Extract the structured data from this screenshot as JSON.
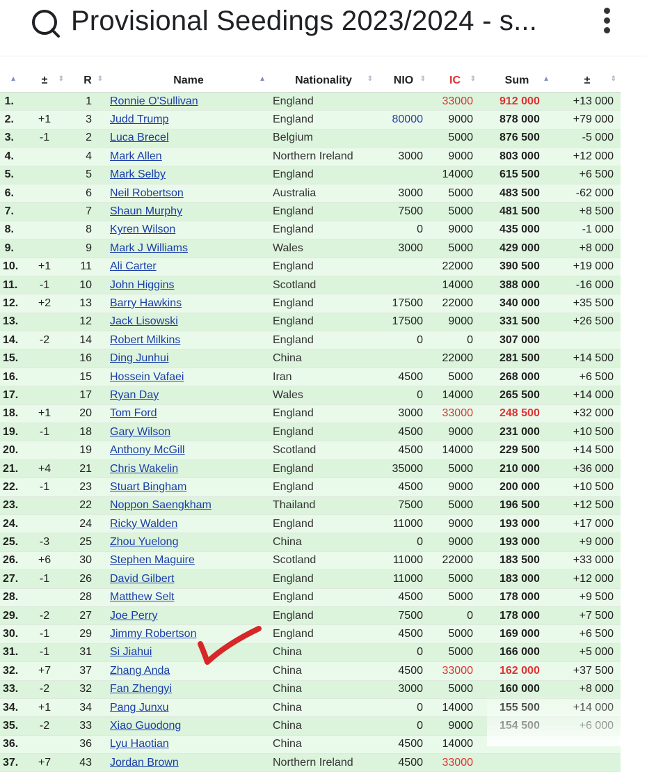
{
  "header": {
    "title": "Provisional Seedings 2023/2024 - s..."
  },
  "columns": [
    "",
    "±",
    "R",
    "Name",
    "Nationality",
    "NIO",
    "IC",
    "Sum",
    "±"
  ],
  "rows": [
    {
      "pos": "1.",
      "chg": "",
      "r": "1",
      "name": "Ronnie O'Sullivan",
      "nat": "England",
      "nio": "",
      "ic": "33000",
      "sum": "912 000",
      "diff": "+13 000",
      "ic_red": true,
      "sum_red": true
    },
    {
      "pos": "2.",
      "chg": "+1",
      "r": "3",
      "name": "Judd Trump",
      "nat": "England",
      "nio": "80000",
      "ic": "9000",
      "sum": "878 000",
      "diff": "+79 000",
      "nio_blue": true
    },
    {
      "pos": "3.",
      "chg": "-1",
      "r": "2",
      "name": "Luca Brecel",
      "nat": "Belgium",
      "nio": "",
      "ic": "5000",
      "sum": "876 500",
      "diff": "-5 000"
    },
    {
      "pos": "4.",
      "chg": "",
      "r": "4",
      "name": "Mark Allen",
      "nat": "Northern Ireland",
      "nio": "3000",
      "ic": "9000",
      "sum": "803 000",
      "diff": "+12 000"
    },
    {
      "pos": "5.",
      "chg": "",
      "r": "5",
      "name": "Mark Selby",
      "nat": "England",
      "nio": "",
      "ic": "14000",
      "sum": "615 500",
      "diff": "+6 500"
    },
    {
      "pos": "6.",
      "chg": "",
      "r": "6",
      "name": "Neil Robertson",
      "nat": "Australia",
      "nio": "3000",
      "ic": "5000",
      "sum": "483 500",
      "diff": "-62 000"
    },
    {
      "pos": "7.",
      "chg": "",
      "r": "7",
      "name": "Shaun Murphy",
      "nat": "England",
      "nio": "7500",
      "ic": "5000",
      "sum": "481 500",
      "diff": "+8 500"
    },
    {
      "pos": "8.",
      "chg": "",
      "r": "8",
      "name": "Kyren Wilson",
      "nat": "England",
      "nio": "0",
      "ic": "9000",
      "sum": "435 000",
      "diff": "-1 000"
    },
    {
      "pos": "9.",
      "chg": "",
      "r": "9",
      "name": "Mark J Williams",
      "nat": "Wales",
      "nio": "3000",
      "ic": "5000",
      "sum": "429 000",
      "diff": "+8 000"
    },
    {
      "pos": "10.",
      "chg": "+1",
      "r": "11",
      "name": "Ali Carter",
      "nat": "England",
      "nio": "",
      "ic": "22000",
      "sum": "390 500",
      "diff": "+19 000"
    },
    {
      "pos": "11.",
      "chg": "-1",
      "r": "10",
      "name": "John Higgins",
      "nat": "Scotland",
      "nio": "",
      "ic": "14000",
      "sum": "388 000",
      "diff": "-16 000"
    },
    {
      "pos": "12.",
      "chg": "+2",
      "r": "13",
      "name": "Barry Hawkins",
      "nat": "England",
      "nio": "17500",
      "ic": "22000",
      "sum": "340 000",
      "diff": "+35 500"
    },
    {
      "pos": "13.",
      "chg": "",
      "r": "12",
      "name": "Jack Lisowski",
      "nat": "England",
      "nio": "17500",
      "ic": "9000",
      "sum": "331 500",
      "diff": "+26 500"
    },
    {
      "pos": "14.",
      "chg": "-2",
      "r": "14",
      "name": "Robert Milkins",
      "nat": "England",
      "nio": "0",
      "ic": "0",
      "sum": "307 000",
      "diff": ""
    },
    {
      "pos": "15.",
      "chg": "",
      "r": "16",
      "name": "Ding Junhui",
      "nat": "China",
      "nio": "",
      "ic": "22000",
      "sum": "281 500",
      "diff": "+14 500"
    },
    {
      "pos": "16.",
      "chg": "",
      "r": "15",
      "name": "Hossein Vafaei",
      "nat": "Iran",
      "nio": "4500",
      "ic": "5000",
      "sum": "268 000",
      "diff": "+6 500"
    },
    {
      "pos": "17.",
      "chg": "",
      "r": "17",
      "name": "Ryan Day",
      "nat": "Wales",
      "nio": "0",
      "ic": "14000",
      "sum": "265 500",
      "diff": "+14 000"
    },
    {
      "pos": "18.",
      "chg": "+1",
      "r": "20",
      "name": "Tom Ford",
      "nat": "England",
      "nio": "3000",
      "ic": "33000",
      "sum": "248 500",
      "diff": "+32 000",
      "ic_red": true,
      "sum_red": true
    },
    {
      "pos": "19.",
      "chg": "-1",
      "r": "18",
      "name": "Gary Wilson",
      "nat": "England",
      "nio": "4500",
      "ic": "9000",
      "sum": "231 000",
      "diff": "+10 500"
    },
    {
      "pos": "20.",
      "chg": "",
      "r": "19",
      "name": "Anthony McGill",
      "nat": "Scotland",
      "nio": "4500",
      "ic": "14000",
      "sum": "229 500",
      "diff": "+14 500"
    },
    {
      "pos": "21.",
      "chg": "+4",
      "r": "21",
      "name": "Chris Wakelin",
      "nat": "England",
      "nio": "35000",
      "ic": "5000",
      "sum": "210 000",
      "diff": "+36 000"
    },
    {
      "pos": "22.",
      "chg": "-1",
      "r": "23",
      "name": "Stuart Bingham",
      "nat": "England",
      "nio": "4500",
      "ic": "9000",
      "sum": "200 000",
      "diff": "+10 500"
    },
    {
      "pos": "23.",
      "chg": "",
      "r": "22",
      "name": "Noppon Saengkham",
      "nat": "Thailand",
      "nio": "7500",
      "ic": "5000",
      "sum": "196 500",
      "diff": "+12 500"
    },
    {
      "pos": "24.",
      "chg": "",
      "r": "24",
      "name": "Ricky Walden",
      "nat": "England",
      "nio": "11000",
      "ic": "9000",
      "sum": "193 000",
      "diff": "+17 000"
    },
    {
      "pos": "25.",
      "chg": "-3",
      "r": "25",
      "name": "Zhou Yuelong",
      "nat": "China",
      "nio": "0",
      "ic": "9000",
      "sum": "193 000",
      "diff": "+9 000"
    },
    {
      "pos": "26.",
      "chg": "+6",
      "r": "30",
      "name": "Stephen Maguire",
      "nat": "Scotland",
      "nio": "11000",
      "ic": "22000",
      "sum": "183 500",
      "diff": "+33 000"
    },
    {
      "pos": "27.",
      "chg": "-1",
      "r": "26",
      "name": "David Gilbert",
      "nat": "England",
      "nio": "11000",
      "ic": "5000",
      "sum": "183 000",
      "diff": "+12 000"
    },
    {
      "pos": "28.",
      "chg": "",
      "r": "28",
      "name": "Matthew Selt",
      "nat": "England",
      "nio": "4500",
      "ic": "5000",
      "sum": "178 000",
      "diff": "+9 500"
    },
    {
      "pos": "29.",
      "chg": "-2",
      "r": "27",
      "name": "Joe Perry",
      "nat": "England",
      "nio": "7500",
      "ic": "0",
      "sum": "178 000",
      "diff": "+7 500"
    },
    {
      "pos": "30.",
      "chg": "-1",
      "r": "29",
      "name": "Jimmy Robertson",
      "nat": "England",
      "nio": "4500",
      "ic": "5000",
      "sum": "169 000",
      "diff": "+6 500"
    },
    {
      "pos": "31.",
      "chg": "-1",
      "r": "31",
      "name": "Si Jiahui",
      "nat": "China",
      "nio": "0",
      "ic": "5000",
      "sum": "166 000",
      "diff": "+5 000"
    },
    {
      "pos": "32.",
      "chg": "+7",
      "r": "37",
      "name": "Zhang Anda",
      "nat": "China",
      "nio": "4500",
      "ic": "33000",
      "sum": "162 000",
      "diff": "+37 500",
      "ic_red": true,
      "sum_red": true
    },
    {
      "pos": "33.",
      "chg": "-2",
      "r": "32",
      "name": "Fan Zhengyi",
      "nat": "China",
      "nio": "3000",
      "ic": "5000",
      "sum": "160 000",
      "diff": "+8 000"
    },
    {
      "pos": "34.",
      "chg": "+1",
      "r": "34",
      "name": "Pang Junxu",
      "nat": "China",
      "nio": "0",
      "ic": "14000",
      "sum": "155 500",
      "diff": "+14 000"
    },
    {
      "pos": "35.",
      "chg": "-2",
      "r": "33",
      "name": "Xiao Guodong",
      "nat": "China",
      "nio": "0",
      "ic": "9000",
      "sum": "154 500",
      "diff": "+6 000"
    },
    {
      "pos": "36.",
      "chg": "",
      "r": "36",
      "name": "Lyu Haotian",
      "nat": "China",
      "nio": "4500",
      "ic": "14000",
      "sum": "",
      "diff": ""
    },
    {
      "pos": "37.",
      "chg": "+7",
      "r": "43",
      "name": "Jordan Brown",
      "nat": "Northern Ireland",
      "nio": "4500",
      "ic": "33000",
      "sum": "",
      "diff": "",
      "ic_red": true
    }
  ]
}
